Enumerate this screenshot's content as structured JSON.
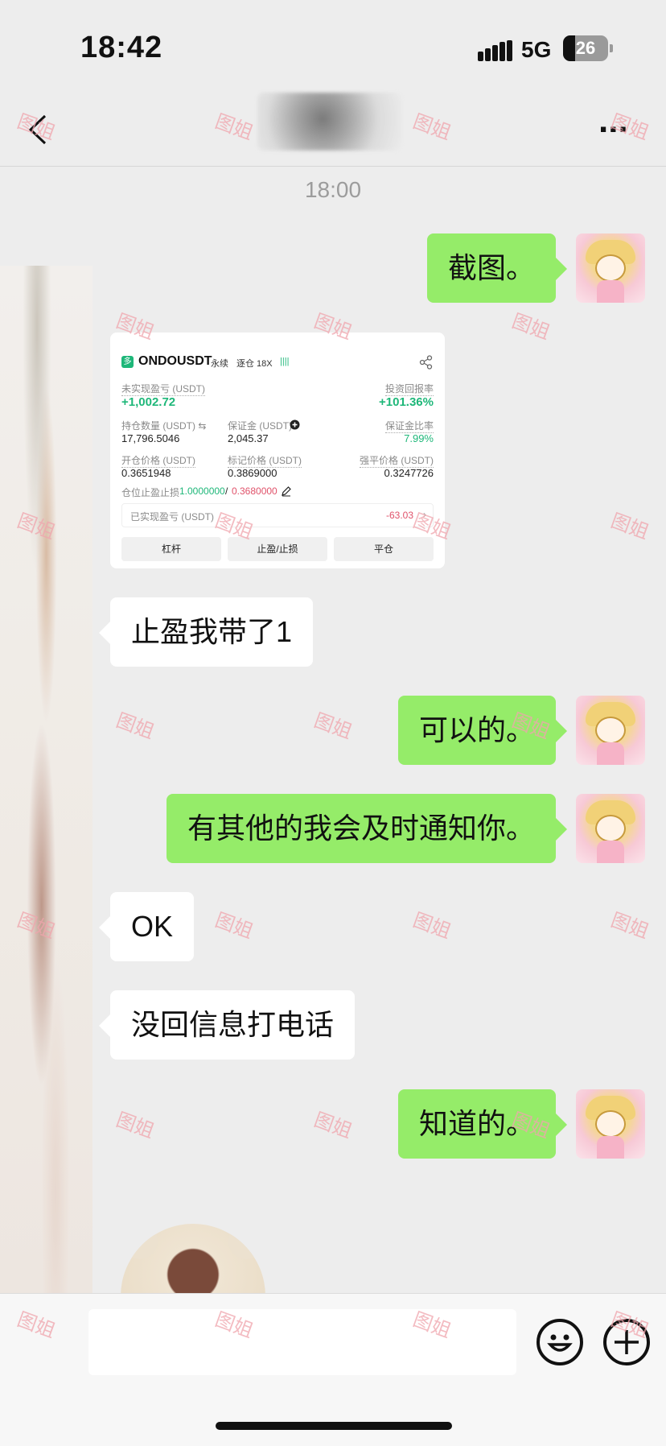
{
  "status_bar": {
    "time": "18:42",
    "network": "5G",
    "battery": "26",
    "battery_level": 0.26
  },
  "header": {
    "back_icon": "chevron-left-icon",
    "more_icon": "more-dots-icon",
    "more_label": "..."
  },
  "chat": {
    "timestamp": "18:00",
    "messages": [
      {
        "from": "me",
        "text": "截图。"
      },
      {
        "from": "them",
        "type": "image"
      },
      {
        "from": "them",
        "text": "止盈我带了1"
      },
      {
        "from": "me",
        "text": "可以的。"
      },
      {
        "from": "me",
        "text": "有其他的我会及时通知你。"
      },
      {
        "from": "them",
        "text": "OK"
      },
      {
        "from": "them",
        "text": "没回信息打电话"
      },
      {
        "from": "me",
        "text": "知道的。"
      }
    ]
  },
  "position_card": {
    "side_badge": "多",
    "symbol": "ONDOUSDT",
    "contract": "永续",
    "margin_mode": "逐仓 18X",
    "bars": "||||",
    "unrealized_label": "未实现盈亏 (USDT)",
    "unrealized_value": "+1,002.72",
    "roi_label": "投资回报率",
    "roi_value": "+101.36%",
    "qty_label": "持仓数量 (USDT) ⇆",
    "qty_value": "17,796.5046",
    "margin_label": "保证金 (USDT)",
    "margin_value": "2,045.37",
    "margin_ratio_label": "保证金比率",
    "margin_ratio_value": "7.99%",
    "entry_label": "开仓价格 (USDT)",
    "entry_value": "0.3651948",
    "mark_label": "标记价格 (USDT)",
    "mark_value": "0.3869000",
    "liq_label": "强平价格 (USDT)",
    "liq_value": "0.3247726",
    "tpsl_label": "仓位止盈止损",
    "tp_value": "1.0000000",
    "tpsl_sep": "/",
    "sl_value": "0.3680000",
    "realized_label": "已实现盈亏 (USDT)",
    "realized_value": "-63.03",
    "buttons": [
      "杠杆",
      "止盈/止损",
      "平仓"
    ],
    "colors": {
      "positive": "#1eb779",
      "negative": "#e0526a"
    }
  },
  "watermark": "图姐",
  "input": {
    "emoji_icon": "emoji-icon",
    "plus_icon": "plus-circle-icon"
  },
  "colors": {
    "my_bubble": "#95ec69",
    "their_bubble": "#ffffff",
    "background": "#ededed"
  }
}
